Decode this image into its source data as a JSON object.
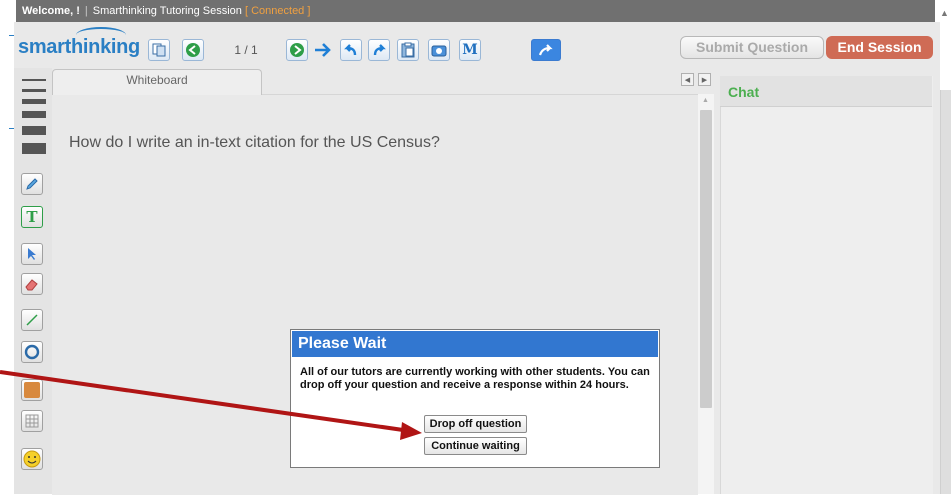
{
  "topbar": {
    "welcome": "Welcome, !",
    "sep": "|",
    "session_label": "Smarthinking Tutoring Session",
    "status": "[ Connected ]"
  },
  "logo": {
    "text": "smarthinking"
  },
  "toolbar": {
    "page_indicator": "1 / 1",
    "icons": [
      "copy-icon",
      "previous-page-icon",
      "next-page-icon",
      "forward-arrow-icon",
      "undo-icon",
      "redo-icon",
      "paste-icon",
      "camera-icon",
      "math-icon",
      "share-icon"
    ]
  },
  "actions": {
    "submit_label": "Submit Question",
    "end_label": "End Session",
    "end_color": "#cf6b55"
  },
  "whiteboard": {
    "tab_label": "Whiteboard",
    "text": "How do I write an in-text citation for the US Census?"
  },
  "tools": [
    "line-width",
    "pencil-icon",
    "text-tool-icon",
    "select-arrow-icon",
    "eraser-icon",
    "line-tool-icon",
    "ellipse-tool-icon",
    "fill-color-icon",
    "grid-icon",
    "emoji-icon"
  ],
  "chat": {
    "title": "Chat",
    "title_color": "#4caf50"
  },
  "dialog": {
    "title": "Please Wait",
    "title_bg": "#3277d0",
    "message": "All of our tutors are currently working with other students. You can drop off your question and receive a response within 24 hours.",
    "drop_off_label": "Drop off question",
    "continue_label": "Continue waiting"
  },
  "annotation": {
    "arrow_color": "#b01515"
  }
}
